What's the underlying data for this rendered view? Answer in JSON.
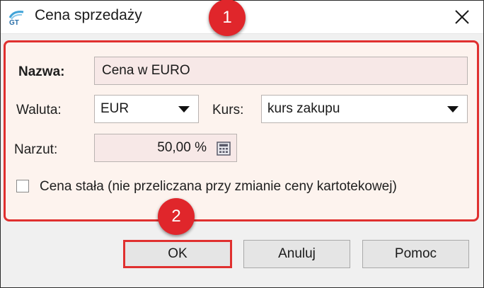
{
  "window": {
    "title": "Cena sprzedaży"
  },
  "markers": [
    "1",
    "2"
  ],
  "form": {
    "name_label": "Nazwa:",
    "name_value": "Cena w EURO",
    "currency_label": "Waluta:",
    "currency_value": "EUR",
    "rate_label": "Kurs:",
    "rate_value": "kurs zakupu",
    "markup_label": "Narzut:",
    "markup_value": "50,00 %",
    "fixed_price_label": "Cena stała (nie przeliczana przy zmianie ceny kartotekowej)",
    "fixed_price_checked": false
  },
  "buttons": {
    "ok": "OK",
    "cancel": "Anuluj",
    "help": "Pomoc"
  },
  "colors": {
    "highlight": "#e0302f",
    "marker": "#e0262b",
    "panel_bg": "#fdf3ee",
    "field_bg": "#f7e8e7"
  },
  "icons": [
    "app-logo-icon",
    "close-icon",
    "calculator-icon",
    "dropdown-arrow-icon"
  ]
}
